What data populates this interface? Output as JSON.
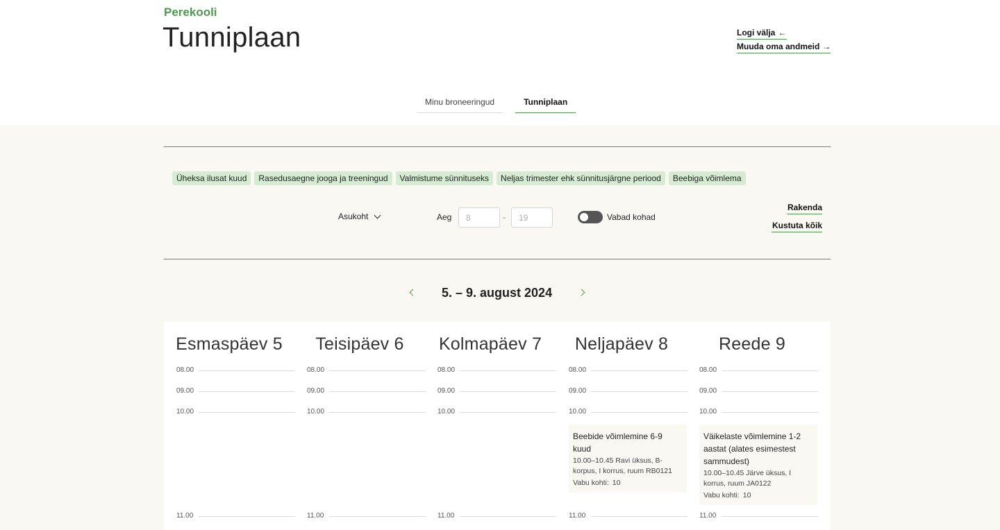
{
  "header": {
    "brand": "Perekooli",
    "title": "Tunniplaan",
    "logout": "Logi välja",
    "edit_profile": "Muuda oma andmeid"
  },
  "tabs": [
    {
      "label": "Minu broneeringud",
      "active": false
    },
    {
      "label": "Tunniplaan",
      "active": true
    }
  ],
  "filters": {
    "categories": [
      "Üheksa ilusat kuud",
      "Rasedusaegne jooga ja treeningud",
      "Valmistume sünnituseks",
      "Neljas trimester ehk sünnitusjärgne periood",
      "Beebiga võimlema"
    ],
    "location_label": "Asukoht",
    "time_label": "Aeg",
    "time_from_placeholder": "8",
    "time_dash": "-",
    "time_to_placeholder": "19",
    "free_places_label": "Vabad kohad",
    "free_places_on": false,
    "apply": "Rakenda",
    "clear_all": "Kustuta kõik"
  },
  "week": {
    "title": "5. – 9. august 2024"
  },
  "calendar": {
    "hours": [
      "08.00",
      "09.00",
      "10.00",
      "11.00"
    ],
    "days": [
      {
        "title": "Esmaspäev 5",
        "events": []
      },
      {
        "title": "Teisipäev 6",
        "events": []
      },
      {
        "title": "Kolmapäev 7",
        "events": []
      },
      {
        "title": "Neljapäev 8",
        "events": [
          {
            "title": "Beebide võimlemine 6-9 kuud",
            "meta": "10.00–10.45 Ravi üksus, B-korpus, I korrus, ruum RB0121",
            "seats_label": "Vabu kohti:",
            "seats": "10"
          }
        ]
      },
      {
        "title": "Reede 9",
        "events": [
          {
            "title": "Väikelaste võimlemine 1-2 aastat (alates esimestest sammudest)",
            "meta": "10.00–10.45 Järve üksus, I korrus, ruum JA0122",
            "seats_label": "Vabu kohti:",
            "seats": "10"
          }
        ]
      }
    ]
  },
  "colors": {
    "accent": "#4e9a4f",
    "chip_bg": "#d6ecd2",
    "panel_bg": "#f9f8f3"
  }
}
